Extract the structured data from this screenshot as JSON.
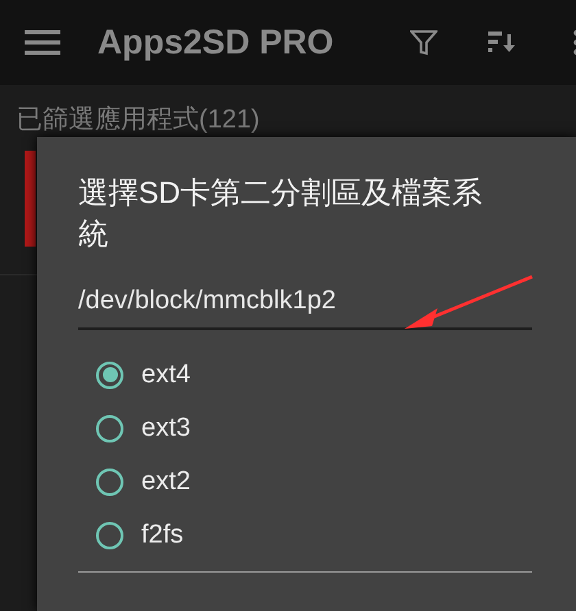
{
  "app_bar": {
    "title": "Apps2SD PRO"
  },
  "subheader": "已篩選應用程式(121)",
  "dialog": {
    "title": "選擇SD卡第二分割區及檔案系統",
    "field": {
      "value": "/dev/block/mmcblk1p2"
    },
    "options": [
      {
        "label": "ext4",
        "selected": true
      },
      {
        "label": "ext3",
        "selected": false
      },
      {
        "label": "ext2",
        "selected": false
      },
      {
        "label": "f2fs",
        "selected": false
      }
    ]
  }
}
